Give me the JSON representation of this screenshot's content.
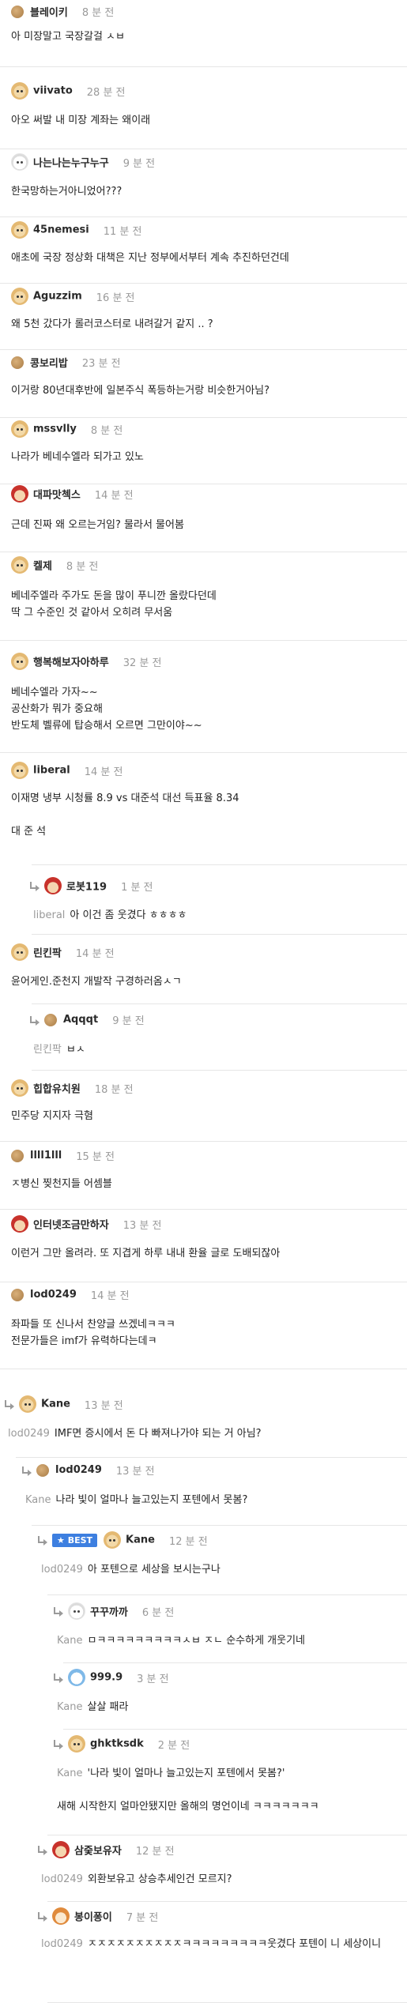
{
  "comments": [
    {
      "nick": "블레이키",
      "time": "8 분 전",
      "text": "아 미장말고 국장갈걸 ㅅㅂ",
      "avatar": "dot"
    },
    {
      "nick": "viivato",
      "time": "28 분 전",
      "text": "아오 써발 내 미장 계좌는 왜이래",
      "avatar": "dog"
    },
    {
      "nick": "나는나는누구누구",
      "time": "9 분 전",
      "text": "한국망하는거아니었어???",
      "avatar": "white"
    },
    {
      "nick": "45nemesi",
      "time": "11 분 전",
      "text": "애초에 국장 정상화 대책은 지난 정부에서부터 계속 추진하던건데",
      "avatar": "dog"
    },
    {
      "nick": "Aguzzim",
      "time": "16 분 전",
      "text": "왜 5천 갔다가 롤러코스터로 내려갈거 같지 .. ?",
      "avatar": "dog"
    },
    {
      "nick": "콩보리밥",
      "time": "23 분 전",
      "text": "이거랑 80년대후반에 일본주식 폭등하는거랑 비슷한거아님?",
      "avatar": "dot"
    },
    {
      "nick": "mssvlly",
      "time": "8 분 전",
      "text": "나라가 베네수엘라 되가고 있노",
      "avatar": "dog"
    },
    {
      "nick": "대파맛첵스",
      "time": "14 분 전",
      "text": "근데 진짜 왜 오르는거임? 물라서 물어봄",
      "avatar": "red"
    },
    {
      "nick": "켈제",
      "time": "8 분 전",
      "text": "베네주엘라 주가도 돈을 많이 푸니깐 올랐다던데\n딱 그 수준인 것 같아서 오히려 무서움",
      "avatar": "dog"
    },
    {
      "nick": "행복해보자아하루",
      "time": "32 분 전",
      "text": "베네수엘라 가자~~\n공산화가 뭐가 중요해\n반도체 벨류에 탑승해서 오르면 그만이야~~",
      "avatar": "dog"
    },
    {
      "nick": "liberal",
      "time": "14 분 전",
      "text": "이재명 냉부 시청률 8.9 vs 대준석 대선 득표율 8.34\n\n대 준 석",
      "avatar": "dog"
    },
    {
      "nick": "로봇119",
      "time": "1 분 전",
      "mention": "liberal",
      "text": "아 이건 좀 웃겼다 ㅎㅎㅎㅎ",
      "avatar": "red"
    },
    {
      "nick": "린킨팍",
      "time": "14 분 전",
      "text": "윤어게인.준천지 개발작 구경하러옴ㅅㄱ",
      "avatar": "dog"
    },
    {
      "nick": "Aqqqt",
      "time": "9 분 전",
      "mention": "린킨팍",
      "text": "ㅂㅅ",
      "avatar": "dot"
    },
    {
      "nick": "힙합유치원",
      "time": "18 분 전",
      "text": "민주당 지지자 극혐",
      "avatar": "dog"
    },
    {
      "nick": "llll1lll",
      "time": "15 분 전",
      "text": "ㅈ병신 찢천지들 어셈블",
      "avatar": "dot"
    },
    {
      "nick": "인터넷조금만하자",
      "time": "13 분 전",
      "text": "이런거 그만 올려라. 또 지겹게 하루 내내 환율 글로 도배되잖아",
      "avatar": "red"
    },
    {
      "nick": "lod0249",
      "time": "14 분 전",
      "text": "좌파들 또 신나서 찬양글 쓰겠네ㅋㅋㅋ\n전문가들은 imf가 유력하다는데ㅋ",
      "avatar": "dot"
    },
    {
      "nick": "Kane",
      "time": "13 분 전",
      "mention": "lod0249",
      "text": "IMF면 증시에서 돈 다 빠져나가야 되는 거 아님?",
      "avatar": "dog"
    },
    {
      "nick": "lod0249",
      "time": "13 분 전",
      "mention": "Kane",
      "text": "나라 빛이 얼마나 늘고있는지 포텐에서 못봄?",
      "avatar": "dot"
    },
    {
      "nick": "Kane",
      "time": "12 분 전",
      "best": "BEST",
      "mention": "lod0249",
      "text": "아 포텐으로 세상을 보시는구나",
      "avatar": "dog"
    },
    {
      "nick": "꾸꾸까까",
      "time": "6 분 전",
      "mention": "Kane",
      "text": "ㅁㅋㅋㅋㅋㅋㅋㅋㅋㅋㅅㅂ ㅈㄴ 순수하게 개웃기네",
      "avatar": "white"
    },
    {
      "nick": "999.9",
      "time": "3 분 전",
      "mention": "Kane",
      "text": "살살 패라",
      "avatar": "blue"
    },
    {
      "nick": "ghktksdk",
      "time": "2 분 전",
      "mention": "Kane",
      "text": "'나라 빛이 얼마나 늘고있는지 포텐에서 못봄?'\n\n새해 시작한지 얼마안됐지만 올해의 명언이네 ㅋㅋㅋㅋㅋㅋㅋ",
      "avatar": "dog"
    },
    {
      "nick": "삼줒보유자",
      "time": "12 분 전",
      "mention": "lod0249",
      "text": "외환보유고 상승추세인건 모르지?",
      "avatar": "red"
    },
    {
      "nick": "봉이퐁이",
      "time": "7 분 전",
      "mention": "lod0249",
      "text": "ㅈㅈㅈㅈㅈㅈㅈㅈㅈㅈㅋㅋㅋㅋㅋㅋㅋㅋㅋ웃겼다 포텐이 니 세상이니",
      "avatar": "shiba"
    }
  ]
}
